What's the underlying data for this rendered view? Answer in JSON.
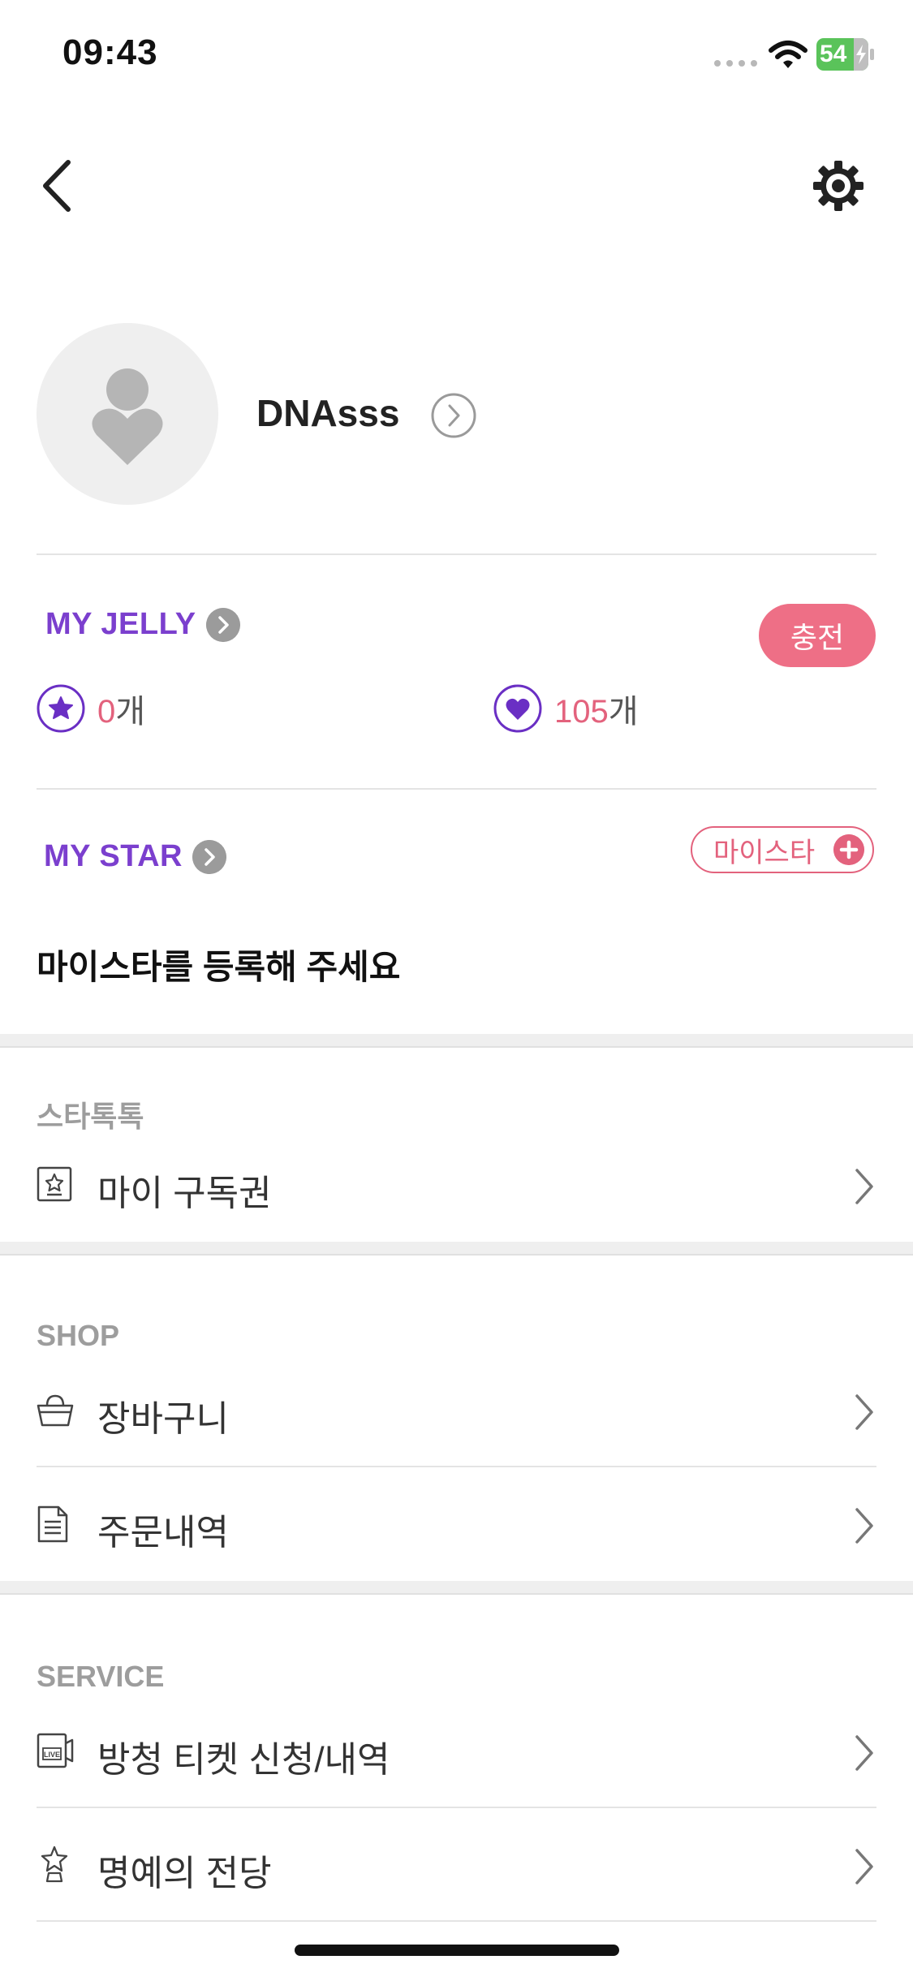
{
  "status_bar": {
    "time": "09:43",
    "battery": "54"
  },
  "header": {
    "back_icon": "chevron-left-icon",
    "settings_icon": "gear-icon"
  },
  "profile": {
    "username": "DNAsss"
  },
  "jelly": {
    "title": "MY JELLY",
    "charge_label": "충전",
    "star_jelly": {
      "value": "0",
      "unit": "개"
    },
    "heart_jelly": {
      "value": "105",
      "unit": "개"
    }
  },
  "mystar": {
    "title": "MY STAR",
    "button_label": "마이스타",
    "empty_message": "마이스타를 등록해 주세요"
  },
  "groups": [
    {
      "title": "스타톡톡",
      "items": [
        {
          "label": "마이 구독권",
          "icon": "ticket-star-icon"
        }
      ]
    },
    {
      "title": "SHOP",
      "items": [
        {
          "label": "장바구니",
          "icon": "basket-icon"
        },
        {
          "label": "주문내역",
          "icon": "document-icon"
        }
      ]
    },
    {
      "title": "SERVICE",
      "items": [
        {
          "label": "방청 티켓 신청/내역",
          "icon": "live-ticket-icon"
        },
        {
          "label": "명예의 전당",
          "icon": "hall-of-fame-icon"
        }
      ]
    }
  ],
  "colors": {
    "accent_purple": "#7b3fce",
    "accent_pink": "#e3627d",
    "charge_button": "#ee6f86"
  }
}
